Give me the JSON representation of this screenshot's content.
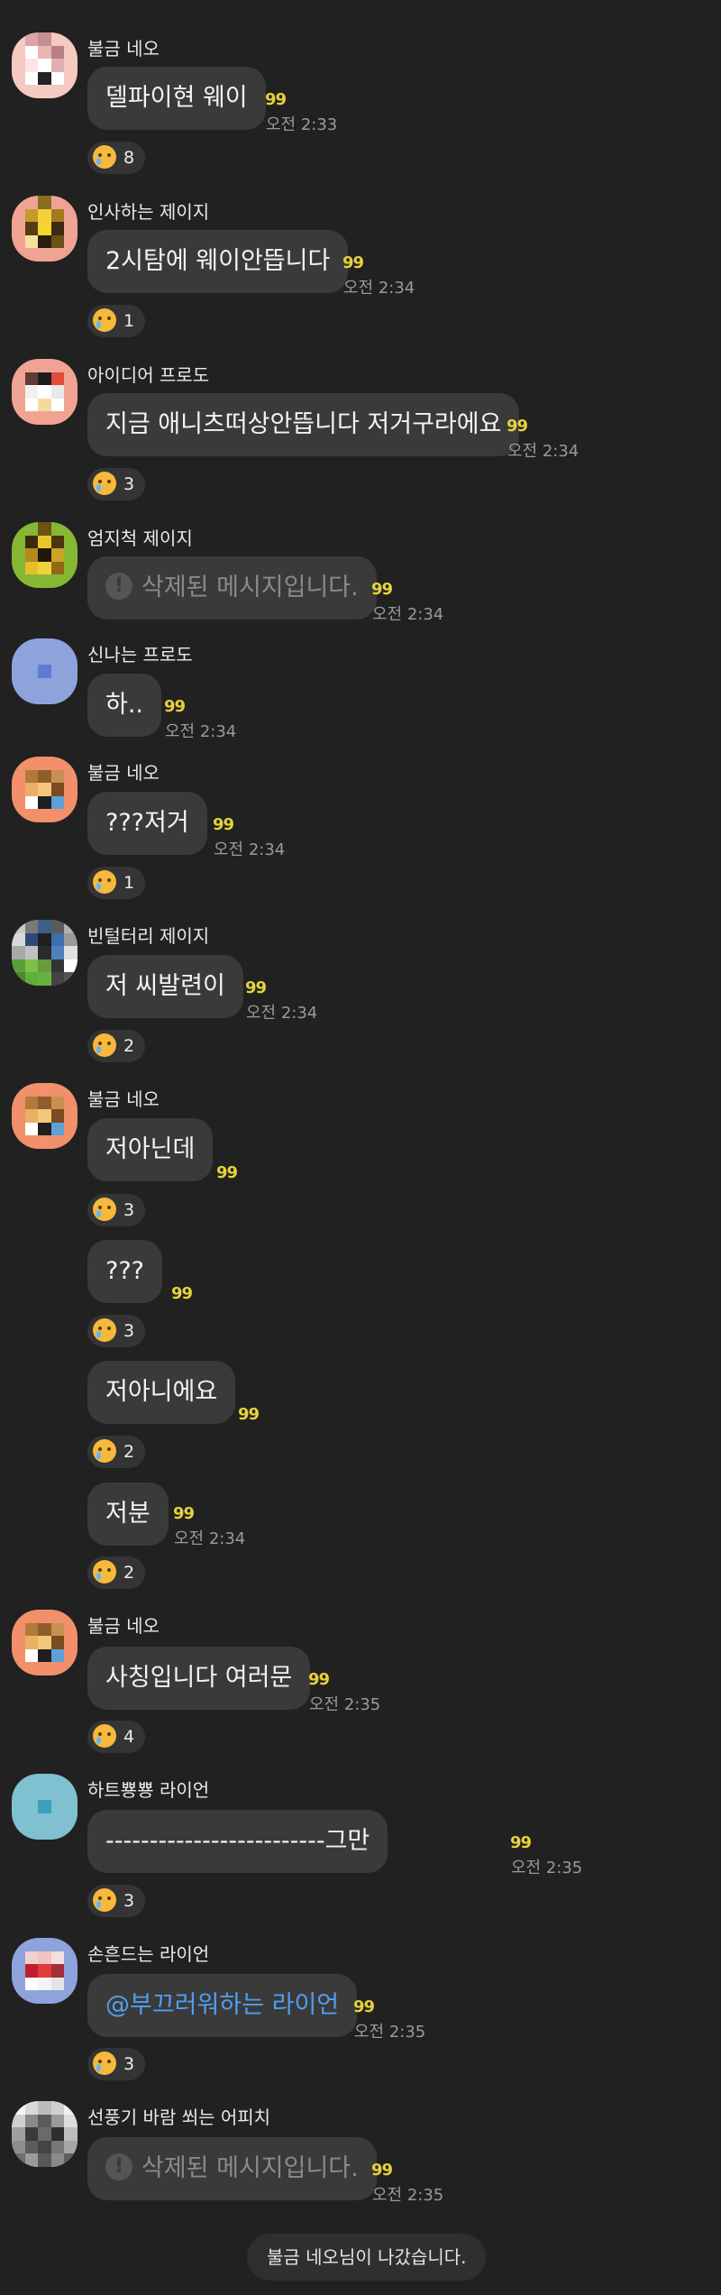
{
  "unread_mark": "99",
  "react_emoji": "crying-face-icon",
  "messages": [
    {
      "sender": "불금 네오",
      "text": "델파이현 웨이",
      "time": "오전 2:33",
      "reaction": "8"
    },
    {
      "sender": "인사하는 제이지",
      "text": "2시탐에 웨이안뜹니다",
      "time": "오전 2:34",
      "reaction": "1"
    },
    {
      "sender": "아이디어 프로도",
      "text": "지금 애니츠떠상안뜹니다 저거구라에요",
      "time": "오전 2:34",
      "reaction": "3"
    },
    {
      "sender": "엄지척 제이지",
      "text": "삭제된 메시지입니다.",
      "time": "오전 2:34",
      "deleted": true
    },
    {
      "sender": "신나는 프로도",
      "text": "하..",
      "time": "오전 2:34"
    },
    {
      "sender": "불금 네오",
      "text": "???저거",
      "time": "오전 2:34",
      "reaction": "1"
    },
    {
      "sender": "빈털터리 제이지",
      "text": "저 씨발련이",
      "time": "오전 2:34",
      "reaction": "2"
    },
    {
      "sender": "불금 네오",
      "text": "저아닌데",
      "time": "",
      "reaction": "3"
    },
    {
      "sender": "",
      "text": "???",
      "time": "",
      "reaction": "3"
    },
    {
      "sender": "",
      "text": "저아니에요",
      "time": "",
      "reaction": "2"
    },
    {
      "sender": "",
      "text": "저분",
      "time": "오전 2:34",
      "reaction": "2"
    },
    {
      "sender": "불금 네오",
      "text": "사칭입니다 여러문",
      "time": "오전 2:35",
      "reaction": "4"
    },
    {
      "sender": "하트뿅뿅 라이언",
      "text": "-------------------------그만",
      "time": "오전 2:35",
      "reaction": "3"
    },
    {
      "sender": "손흔드는 라이언",
      "text": "@부끄러워하는 라이언",
      "time": "오전 2:35",
      "reaction": "3"
    },
    {
      "sender": "선풍기 바람 쐬는 어피치",
      "text": "삭제된 메시지입니다.",
      "time": "오전 2:35",
      "deleted": true
    }
  ],
  "system_message": "불금 네오님이 나갔습니다."
}
